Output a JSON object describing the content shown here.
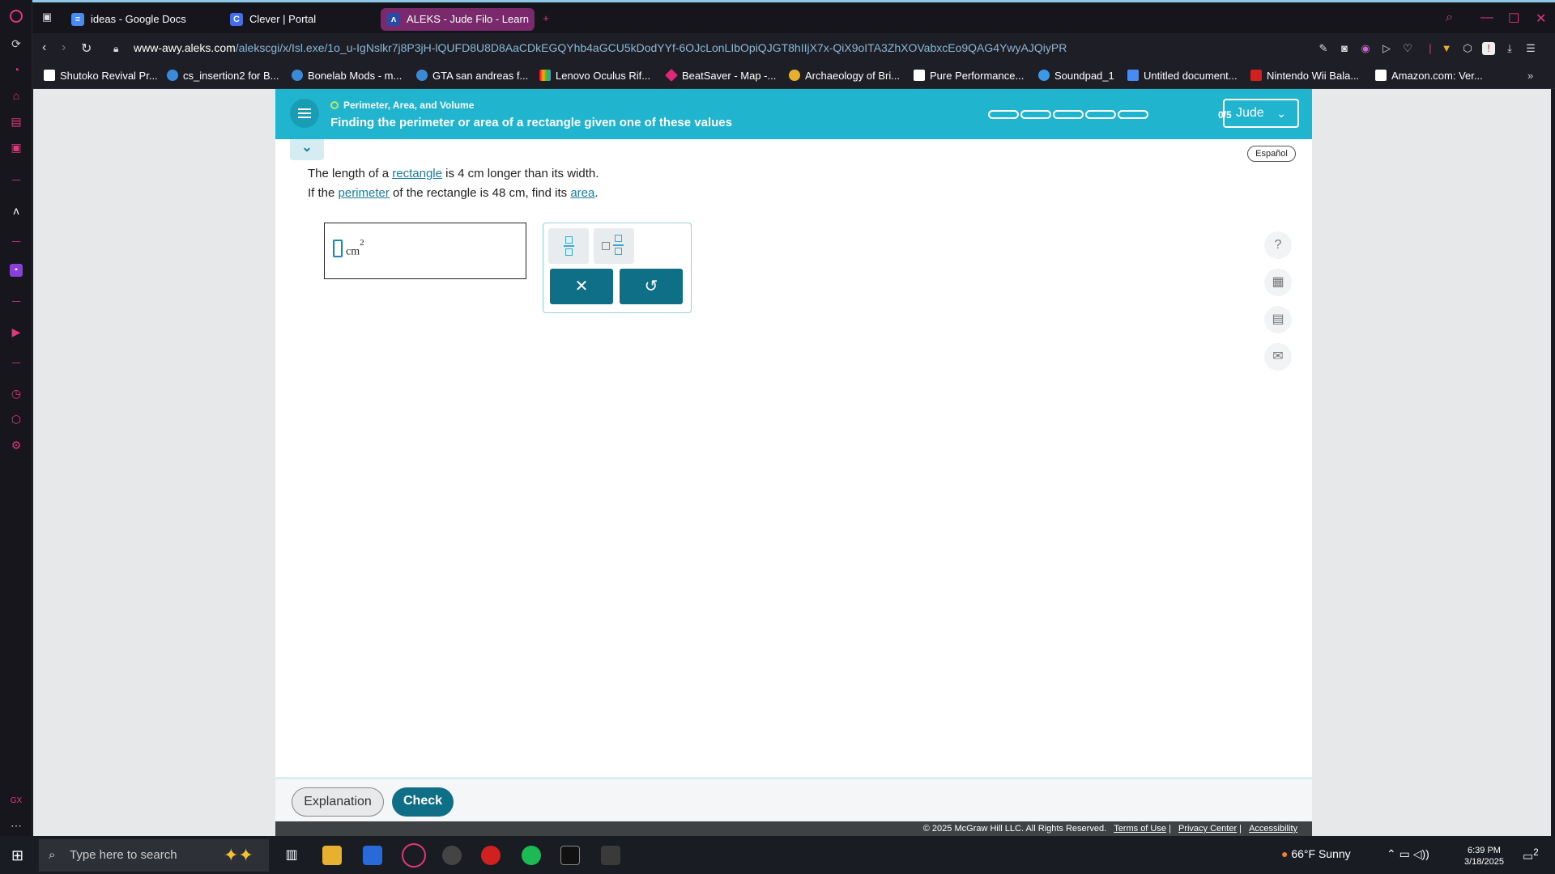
{
  "browser": {
    "tabs": [
      {
        "label": "ideas - Google Docs",
        "icon": "docs-icon",
        "color": "#4a8af4"
      },
      {
        "label": "Clever | Portal",
        "icon": "clever-icon",
        "color": "#436cf2"
      },
      {
        "label": "ALEKS - Jude Filo - Learn",
        "icon": "aleks-icon",
        "color": "#7a2a6c"
      }
    ],
    "url_domain": "www-awy.aleks.com",
    "url_path": "/alekscgi/x/Isl.exe/1o_u-IgNslkr7j8P3jH-lQUFD8U8D8AaCDkEGQYhb4aGCU5kDodYYf-6OJcLonLIbOpiQJGT8hIIjX7x-QiX9oITA3ZhXOVabxcEo9QAG4YwyAJQiyPR",
    "bookmarks": [
      "Shutoko Revival Pr...",
      "cs_insertion2 for B...",
      "Bonelab Mods - m...",
      "GTA san andreas f...",
      "Lenovo Oculus Rif...",
      "BeatSaver - Map -...",
      "Archaeology of Bri...",
      "Pure Performance...",
      "Soundpad_1",
      "Untitled document...",
      "Nintendo Wii Bala...",
      "Amazon.com: Ver..."
    ]
  },
  "aleks": {
    "topic": "Perimeter, Area, and Volume",
    "title": "Finding the perimeter or area of a rectangle given one of these values",
    "progress_text": "0/5",
    "progress": 0,
    "user": "Jude",
    "espanol": "Español",
    "question": {
      "line1_a": "The length of a ",
      "link_rectangle": "rectangle",
      "line1_b": " is 4 cm longer than its width.",
      "line2_a": "If the ",
      "link_perimeter": "perimeter",
      "line2_b": " of the rectangle is 48 cm, find its ",
      "link_area": "area",
      "line2_c": "."
    },
    "answer_unit": "cm",
    "answer_exp": "2",
    "buttons": {
      "explanation": "Explanation",
      "check": "Check"
    },
    "footer": {
      "copyright": "© 2025 McGraw Hill LLC. All Rights Reserved.",
      "terms": "Terms of Use",
      "privacy": "Privacy Center",
      "accessibility": "Accessibility"
    },
    "accent": "#20b4cf"
  },
  "taskbar": {
    "search_placeholder": "Type here to search",
    "weather": "66°F  Sunny",
    "time": "6:39 PM",
    "date": "3/18/2025",
    "notifications": "2"
  }
}
